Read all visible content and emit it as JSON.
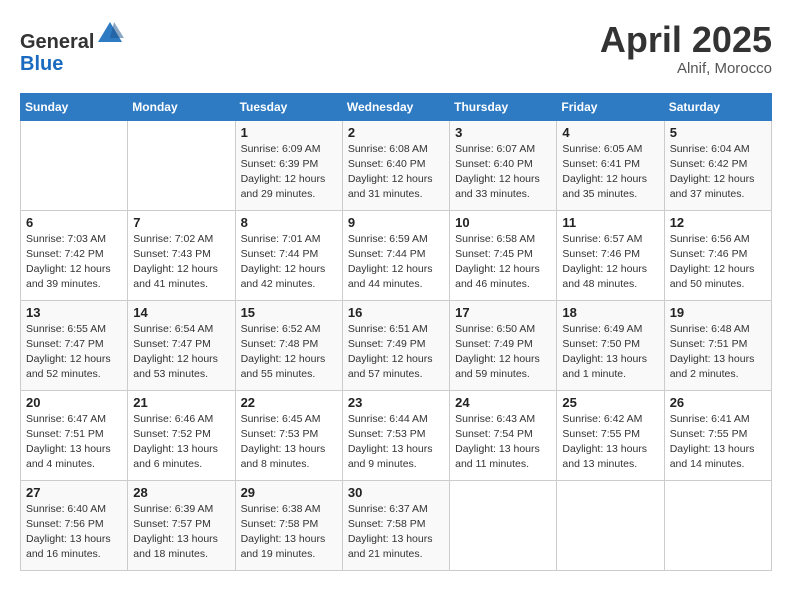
{
  "header": {
    "logo_line1": "General",
    "logo_line2": "Blue",
    "month_title": "April 2025",
    "location": "Alnif, Morocco"
  },
  "days_of_week": [
    "Sunday",
    "Monday",
    "Tuesday",
    "Wednesday",
    "Thursday",
    "Friday",
    "Saturday"
  ],
  "weeks": [
    [
      {
        "day": "",
        "info": ""
      },
      {
        "day": "",
        "info": ""
      },
      {
        "day": "1",
        "info": "Sunrise: 6:09 AM\nSunset: 6:39 PM\nDaylight: 12 hours\nand 29 minutes."
      },
      {
        "day": "2",
        "info": "Sunrise: 6:08 AM\nSunset: 6:40 PM\nDaylight: 12 hours\nand 31 minutes."
      },
      {
        "day": "3",
        "info": "Sunrise: 6:07 AM\nSunset: 6:40 PM\nDaylight: 12 hours\nand 33 minutes."
      },
      {
        "day": "4",
        "info": "Sunrise: 6:05 AM\nSunset: 6:41 PM\nDaylight: 12 hours\nand 35 minutes."
      },
      {
        "day": "5",
        "info": "Sunrise: 6:04 AM\nSunset: 6:42 PM\nDaylight: 12 hours\nand 37 minutes."
      }
    ],
    [
      {
        "day": "6",
        "info": "Sunrise: 7:03 AM\nSunset: 7:42 PM\nDaylight: 12 hours\nand 39 minutes."
      },
      {
        "day": "7",
        "info": "Sunrise: 7:02 AM\nSunset: 7:43 PM\nDaylight: 12 hours\nand 41 minutes."
      },
      {
        "day": "8",
        "info": "Sunrise: 7:01 AM\nSunset: 7:44 PM\nDaylight: 12 hours\nand 42 minutes."
      },
      {
        "day": "9",
        "info": "Sunrise: 6:59 AM\nSunset: 7:44 PM\nDaylight: 12 hours\nand 44 minutes."
      },
      {
        "day": "10",
        "info": "Sunrise: 6:58 AM\nSunset: 7:45 PM\nDaylight: 12 hours\nand 46 minutes."
      },
      {
        "day": "11",
        "info": "Sunrise: 6:57 AM\nSunset: 7:46 PM\nDaylight: 12 hours\nand 48 minutes."
      },
      {
        "day": "12",
        "info": "Sunrise: 6:56 AM\nSunset: 7:46 PM\nDaylight: 12 hours\nand 50 minutes."
      }
    ],
    [
      {
        "day": "13",
        "info": "Sunrise: 6:55 AM\nSunset: 7:47 PM\nDaylight: 12 hours\nand 52 minutes."
      },
      {
        "day": "14",
        "info": "Sunrise: 6:54 AM\nSunset: 7:47 PM\nDaylight: 12 hours\nand 53 minutes."
      },
      {
        "day": "15",
        "info": "Sunrise: 6:52 AM\nSunset: 7:48 PM\nDaylight: 12 hours\nand 55 minutes."
      },
      {
        "day": "16",
        "info": "Sunrise: 6:51 AM\nSunset: 7:49 PM\nDaylight: 12 hours\nand 57 minutes."
      },
      {
        "day": "17",
        "info": "Sunrise: 6:50 AM\nSunset: 7:49 PM\nDaylight: 12 hours\nand 59 minutes."
      },
      {
        "day": "18",
        "info": "Sunrise: 6:49 AM\nSunset: 7:50 PM\nDaylight: 13 hours\nand 1 minute."
      },
      {
        "day": "19",
        "info": "Sunrise: 6:48 AM\nSunset: 7:51 PM\nDaylight: 13 hours\nand 2 minutes."
      }
    ],
    [
      {
        "day": "20",
        "info": "Sunrise: 6:47 AM\nSunset: 7:51 PM\nDaylight: 13 hours\nand 4 minutes."
      },
      {
        "day": "21",
        "info": "Sunrise: 6:46 AM\nSunset: 7:52 PM\nDaylight: 13 hours\nand 6 minutes."
      },
      {
        "day": "22",
        "info": "Sunrise: 6:45 AM\nSunset: 7:53 PM\nDaylight: 13 hours\nand 8 minutes."
      },
      {
        "day": "23",
        "info": "Sunrise: 6:44 AM\nSunset: 7:53 PM\nDaylight: 13 hours\nand 9 minutes."
      },
      {
        "day": "24",
        "info": "Sunrise: 6:43 AM\nSunset: 7:54 PM\nDaylight: 13 hours\nand 11 minutes."
      },
      {
        "day": "25",
        "info": "Sunrise: 6:42 AM\nSunset: 7:55 PM\nDaylight: 13 hours\nand 13 minutes."
      },
      {
        "day": "26",
        "info": "Sunrise: 6:41 AM\nSunset: 7:55 PM\nDaylight: 13 hours\nand 14 minutes."
      }
    ],
    [
      {
        "day": "27",
        "info": "Sunrise: 6:40 AM\nSunset: 7:56 PM\nDaylight: 13 hours\nand 16 minutes."
      },
      {
        "day": "28",
        "info": "Sunrise: 6:39 AM\nSunset: 7:57 PM\nDaylight: 13 hours\nand 18 minutes."
      },
      {
        "day": "29",
        "info": "Sunrise: 6:38 AM\nSunset: 7:58 PM\nDaylight: 13 hours\nand 19 minutes."
      },
      {
        "day": "30",
        "info": "Sunrise: 6:37 AM\nSunset: 7:58 PM\nDaylight: 13 hours\nand 21 minutes."
      },
      {
        "day": "",
        "info": ""
      },
      {
        "day": "",
        "info": ""
      },
      {
        "day": "",
        "info": ""
      }
    ]
  ]
}
